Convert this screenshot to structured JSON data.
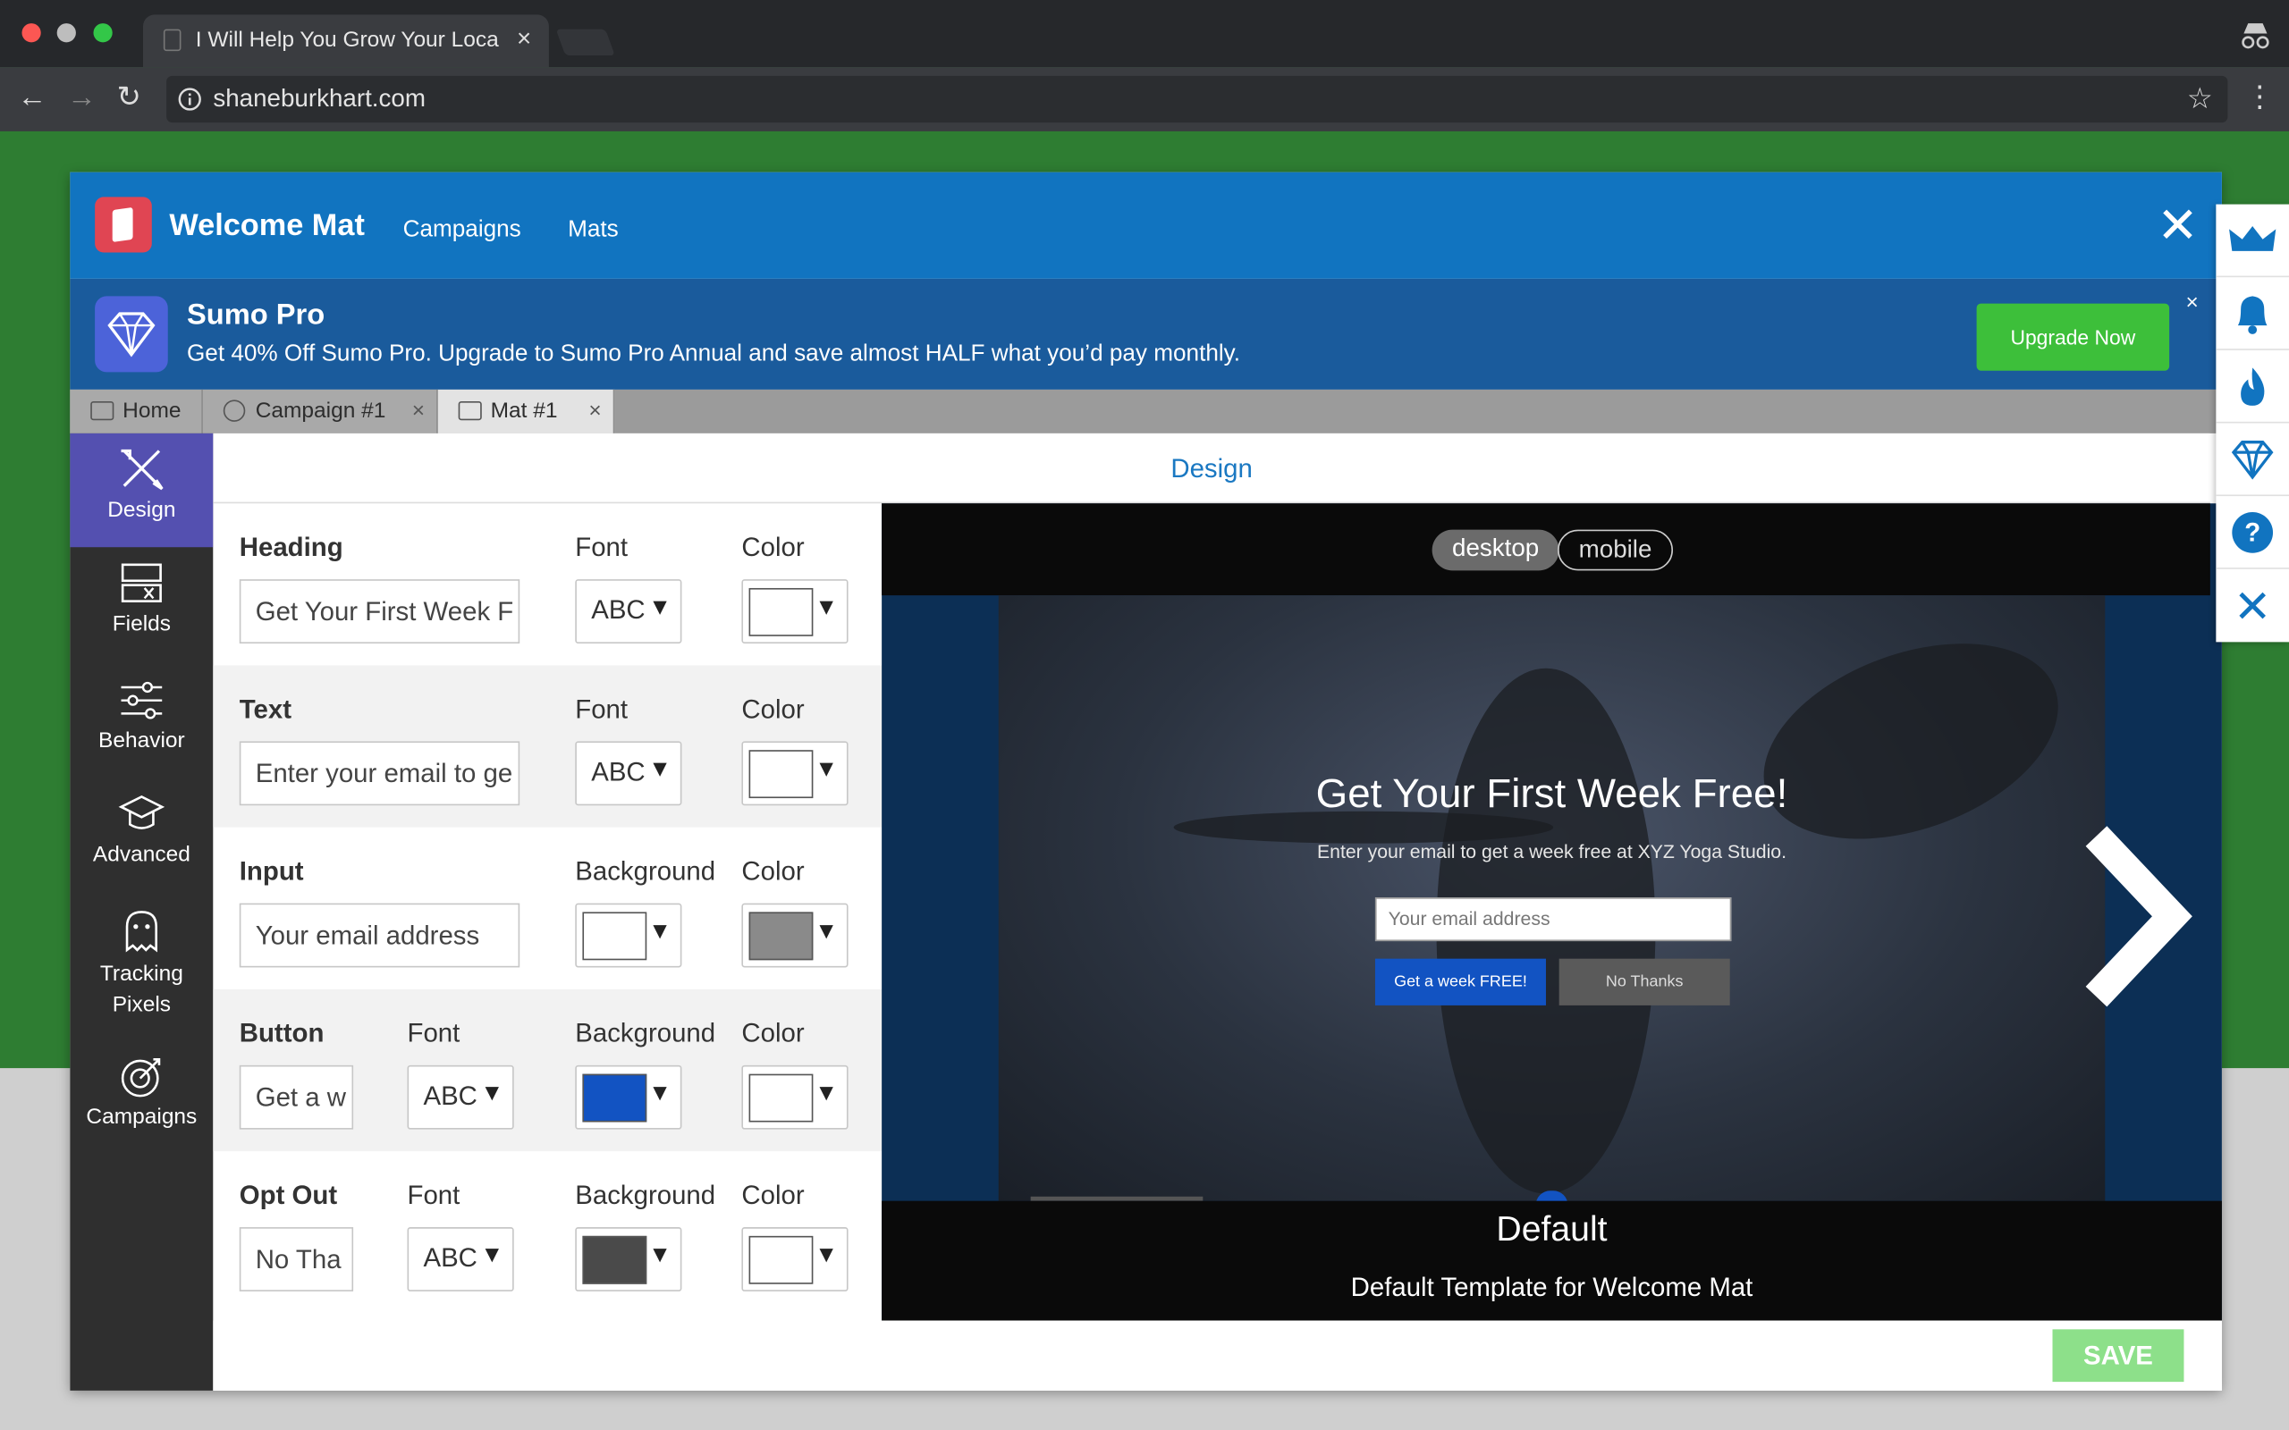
{
  "browser": {
    "tab_title": "I Will Help You Grow Your Loca",
    "tab_close": "×",
    "url": "shaneburkhart.com"
  },
  "header": {
    "brand": "Welcome Mat",
    "nav": [
      "Campaigns",
      "Mats"
    ],
    "close": "✕"
  },
  "promo": {
    "title": "Sumo Pro",
    "description": "Get 40% Off Sumo Pro. Upgrade to Sumo Pro Annual and save almost HALF what you’d pay monthly.",
    "button": "Upgrade Now",
    "close": "×"
  },
  "tabs": [
    {
      "label": "Home",
      "close": ""
    },
    {
      "label": "Campaign #1",
      "close": "×"
    },
    {
      "label": "Mat #1",
      "close": "×"
    }
  ],
  "sidebar": {
    "items": [
      {
        "label": "Design"
      },
      {
        "label": "Fields"
      },
      {
        "label": "Behavior"
      },
      {
        "label": "Advanced"
      },
      {
        "label": "Tracking Pixels"
      },
      {
        "label": "Campaigns"
      }
    ]
  },
  "design": {
    "title": "Design",
    "rows": [
      {
        "label": "Heading",
        "value": "Get Your First Week F",
        "font_label": "Font",
        "font": "ABC",
        "color_label": "Color",
        "color": "#ffffff"
      },
      {
        "label": "Text",
        "value": "Enter your email to ge",
        "font_label": "Font",
        "font": "ABC",
        "color_label": "Color",
        "color": "#ffffff"
      },
      {
        "label": "Input",
        "value": "Your email address",
        "bg_label": "Background",
        "bg": "#ffffff",
        "color_label": "Color",
        "color": "#8a8a8a"
      },
      {
        "label": "Button",
        "value": "Get a w",
        "font_label": "Font",
        "font": "ABC",
        "bg_label": "Background",
        "bg": "#1253c2",
        "color_label": "Color",
        "color": "#ffffff"
      },
      {
        "label": "Opt Out",
        "value": "No Tha",
        "font_label": "Font",
        "font": "ABC",
        "bg_label": "Background",
        "bg": "#4a4a4a",
        "color_label": "Color",
        "color": "#ffffff"
      }
    ],
    "arrow": "▼"
  },
  "preview": {
    "seg_desktop": "desktop",
    "seg_mobile": "mobile",
    "heading": "Get Your First Week Free!",
    "text": "Enter your email to get a week free at XYZ Yoga Studio.",
    "email_placeholder": "Your email address",
    "button": "Get a week FREE!",
    "optout": "No Thanks",
    "template_name": "Default",
    "template_desc": "Default Template for Welcome Mat"
  },
  "save": "SAVE",
  "colors": {
    "accent": "#1174c0",
    "sidebar_active": "#5450b0",
    "upgrade": "#3dbf3a"
  },
  "rail_icons": [
    "crown-icon",
    "bell-icon",
    "flame-icon",
    "diamond-icon",
    "question-icon",
    "close-icon"
  ]
}
